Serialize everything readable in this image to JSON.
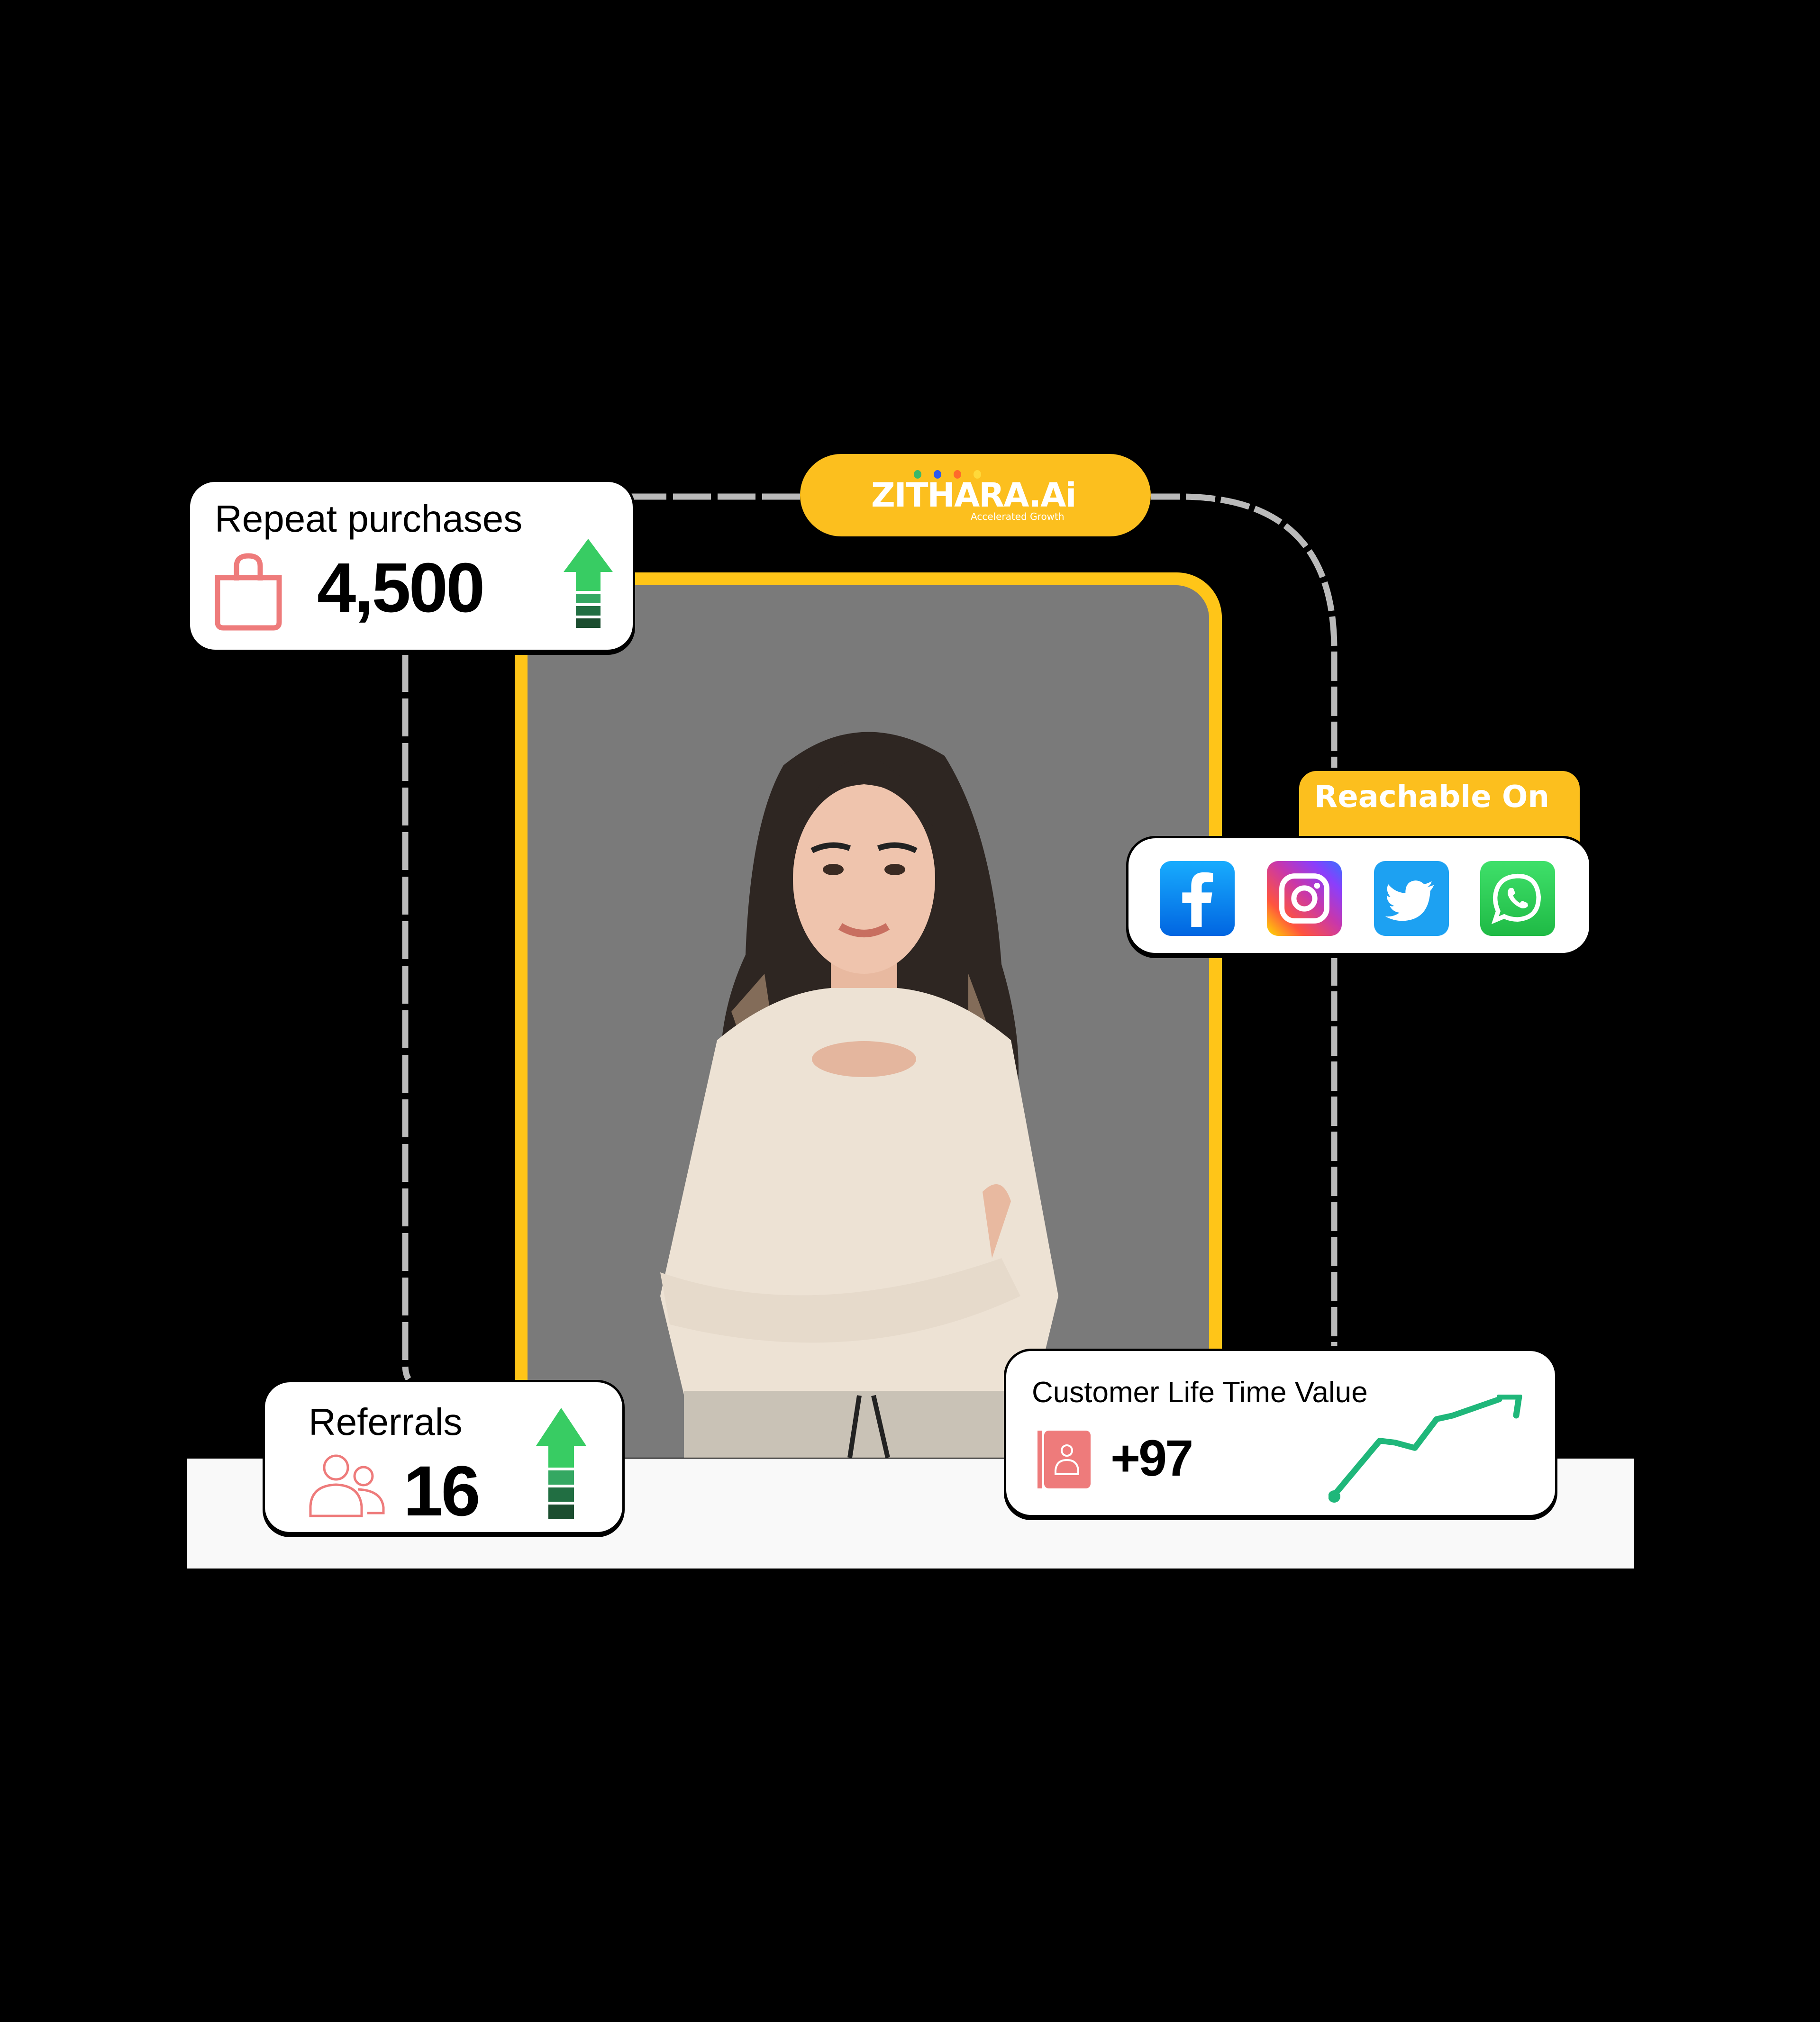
{
  "brand": {
    "name": "ZITHARA.Ai",
    "tagline": "Accelerated Growth",
    "dot_colors": [
      "#3bb86a",
      "#2b59f0",
      "#ff6a2b",
      "#ffd93a"
    ],
    "accent": "#fcbf1e"
  },
  "cards": {
    "repeat_purchases": {
      "title": "Repeat purchases",
      "value": "4,500",
      "icon": "shopping-bag-icon",
      "trend": "up"
    },
    "referrals": {
      "title": "Referrals",
      "value": "16",
      "icon": "users-icon",
      "trend": "up"
    },
    "customer_lifetime_value": {
      "title": "Customer Life Time Value",
      "value": "+97",
      "icon": "contact-book-icon",
      "trend": "up"
    }
  },
  "reachable": {
    "label": "Reachable On",
    "channels": [
      {
        "name": "Facebook",
        "icon": "facebook-icon",
        "color": "#1877f2"
      },
      {
        "name": "Instagram",
        "icon": "instagram-icon",
        "color": "#c837ab"
      },
      {
        "name": "Twitter",
        "icon": "twitter-icon",
        "color": "#1da1f2"
      },
      {
        "name": "WhatsApp",
        "icon": "whatsapp-icon",
        "color": "#25d366"
      }
    ]
  },
  "photo": {
    "subject": "Smiling woman with crossed arms in cream long-sleeve top"
  },
  "colors": {
    "up_arrow": "#38cc63",
    "icon_pink": "#ee7b7b",
    "trend_line": "#1fb77a",
    "connector": "#bababa",
    "frame": "#ffc518"
  }
}
